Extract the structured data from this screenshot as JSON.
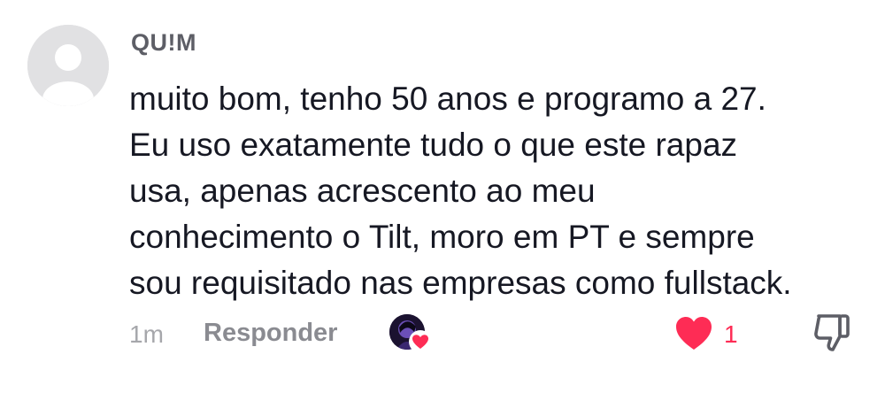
{
  "comment": {
    "username": "QU!M",
    "text": "muito bom, tenho 50 anos e programo a 27.\nEu uso exatamente tudo o que este rapaz\nusa, apenas acrescento ao meu\nconhecimento o Tilt, moro em PT e sempre\nsou requisitado nas empresas como fullstack.",
    "timestamp": "1m",
    "reply_label": "Responder",
    "like_count": "1"
  },
  "icons": {
    "avatar": "default-user-avatar-icon",
    "creator_liked": "creator-liked-heart-icon",
    "like": "heart-icon",
    "dislike": "thumbs-down-icon"
  },
  "colors": {
    "like": "#fe2c55",
    "username": "#5d5e66",
    "text": "#161823",
    "muted": "#a6a7ab",
    "reply": "#8a8b91"
  }
}
